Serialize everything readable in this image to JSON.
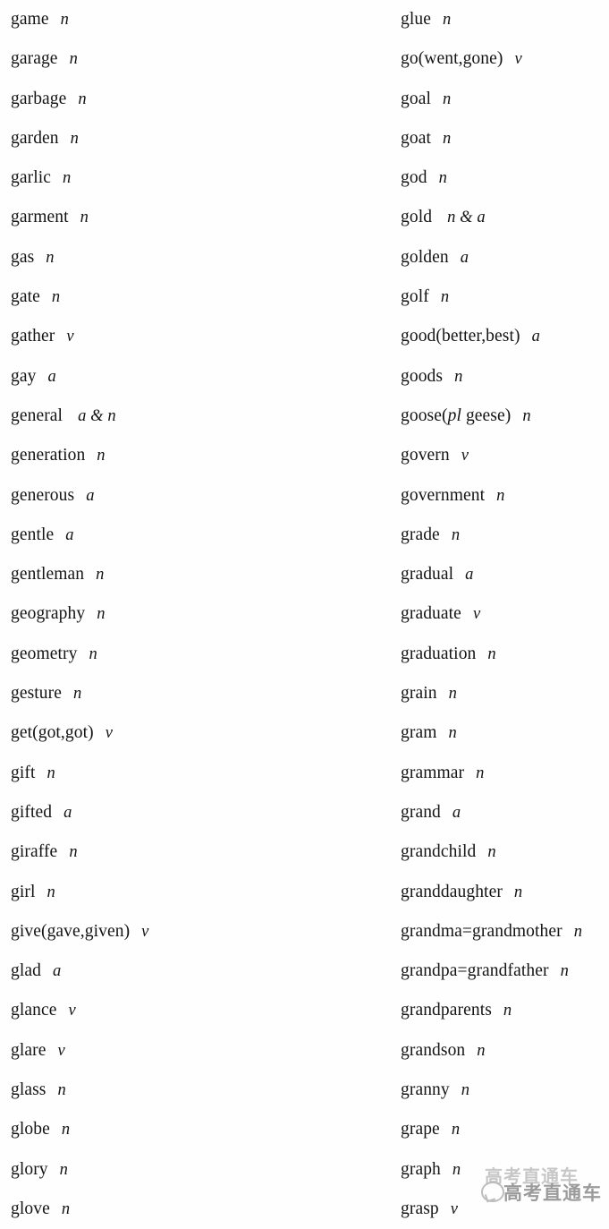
{
  "page": {
    "background_color": "#fefefe",
    "text_color": "#141414",
    "watermark": {
      "back_text": "高考直通车",
      "front_text": "高考直通车",
      "color": "#6e6e6e"
    }
  },
  "columns": {
    "left": [
      {
        "word": "game",
        "pos": "n"
      },
      {
        "word": "garage",
        "pos": "n"
      },
      {
        "word": "garbage",
        "pos": "n"
      },
      {
        "word": "garden",
        "pos": "n"
      },
      {
        "word": "garlic",
        "pos": "n"
      },
      {
        "word": "garment",
        "pos": "n"
      },
      {
        "word": "gas",
        "pos": "n"
      },
      {
        "word": "gate",
        "pos": "n"
      },
      {
        "word": "gather",
        "pos": "v"
      },
      {
        "word": "gay",
        "pos": "a"
      },
      {
        "word": "general",
        "pos": "a & n"
      },
      {
        "word": "generation",
        "pos": "n"
      },
      {
        "word": "generous",
        "pos": "a"
      },
      {
        "word": "gentle",
        "pos": "a"
      },
      {
        "word": "gentleman",
        "pos": "n"
      },
      {
        "word": "geography",
        "pos": "n"
      },
      {
        "word": "geometry",
        "pos": "n"
      },
      {
        "word": "gesture",
        "pos": "n"
      },
      {
        "word": "get(got,got)",
        "pos": "v"
      },
      {
        "word": "gift",
        "pos": "n"
      },
      {
        "word": "gifted",
        "pos": "a"
      },
      {
        "word": "giraffe",
        "pos": "n"
      },
      {
        "word": "girl",
        "pos": "n"
      },
      {
        "word": "give(gave,given)",
        "pos": "v"
      },
      {
        "word": "glad",
        "pos": "a"
      },
      {
        "word": "glance",
        "pos": "v"
      },
      {
        "word": "glare",
        "pos": "v"
      },
      {
        "word": "glass",
        "pos": "n"
      },
      {
        "word": "globe",
        "pos": "n"
      },
      {
        "word": "glory",
        "pos": "n"
      },
      {
        "word": "glove",
        "pos": "n"
      }
    ],
    "right": [
      {
        "word": "glue",
        "pos": "n"
      },
      {
        "word": "go(went,gone)",
        "pos": "v"
      },
      {
        "word": "goal",
        "pos": "n"
      },
      {
        "word": "goat",
        "pos": "n"
      },
      {
        "word": "god",
        "pos": "n"
      },
      {
        "word": "gold",
        "pos": "n & a"
      },
      {
        "word": "golden",
        "pos": "a"
      },
      {
        "word": "golf",
        "pos": "n"
      },
      {
        "word": "good(better,best)",
        "pos": "a"
      },
      {
        "word": "goods",
        "pos": "n"
      },
      {
        "word": "goose(pl geese)",
        "pos": "n",
        "italic_part": "pl"
      },
      {
        "word": "govern",
        "pos": "v"
      },
      {
        "word": "government",
        "pos": "n"
      },
      {
        "word": "grade",
        "pos": "n"
      },
      {
        "word": "gradual",
        "pos": "a"
      },
      {
        "word": "graduate",
        "pos": "v"
      },
      {
        "word": "graduation",
        "pos": "n"
      },
      {
        "word": "grain",
        "pos": "n"
      },
      {
        "word": "gram",
        "pos": "n"
      },
      {
        "word": "grammar",
        "pos": "n"
      },
      {
        "word": "grand",
        "pos": "a"
      },
      {
        "word": "grandchild",
        "pos": "n"
      },
      {
        "word": "granddaughter",
        "pos": "n"
      },
      {
        "word": "grandma=grandmother",
        "pos": "n"
      },
      {
        "word": "grandpa=grandfather",
        "pos": "n"
      },
      {
        "word": "grandparents",
        "pos": "n"
      },
      {
        "word": "grandson",
        "pos": "n"
      },
      {
        "word": "granny",
        "pos": "n"
      },
      {
        "word": "grape",
        "pos": "n"
      },
      {
        "word": "graph",
        "pos": "n"
      },
      {
        "word": "grasp",
        "pos": "v"
      }
    ]
  }
}
